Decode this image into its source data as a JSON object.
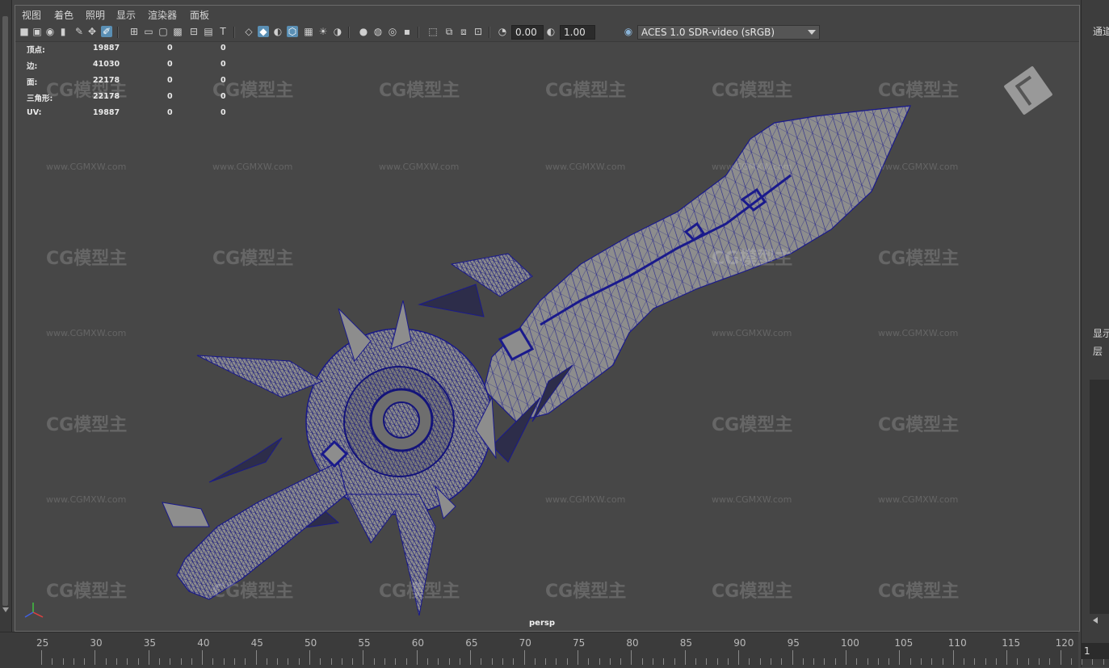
{
  "menu": [
    "视图",
    "着色",
    "照明",
    "显示",
    "渲染器",
    "面板"
  ],
  "toolbar": {
    "exposure_value": "0.00",
    "gamma_value": "1.00",
    "color_space": "ACES 1.0 SDR-video (sRGB)"
  },
  "hud": {
    "rows": [
      {
        "label": "顶点:",
        "total": "19887",
        "selected": "0",
        "tris": "0"
      },
      {
        "label": "边:",
        "total": "41030",
        "selected": "0",
        "tris": "0"
      },
      {
        "label": "面:",
        "total": "22178",
        "selected": "0",
        "tris": "0"
      },
      {
        "label": "三角形:",
        "total": "22178",
        "selected": "0",
        "tris": "0"
      },
      {
        "label": "UV:",
        "total": "19887",
        "selected": "0",
        "tris": "0"
      }
    ]
  },
  "viewport": {
    "camera_label": "persp",
    "watermark_logo": "CG模型主",
    "watermark_url": "www.CGMXW.com"
  },
  "right_panel": {
    "channel_label": "通道",
    "display_label": "显示",
    "layer_label": "层"
  },
  "timeline": {
    "ticks": [
      "25",
      "30",
      "35",
      "40",
      "45",
      "50",
      "55",
      "60",
      "65",
      "70",
      "75",
      "80",
      "85",
      "90",
      "95",
      "100",
      "105",
      "110",
      "115",
      "120"
    ],
    "current_frame": "1"
  },
  "colors": {
    "wire": "#1a1a8c",
    "mesh_fill": "#8d8d8d",
    "viewport_bg": "#474747",
    "active_icon": "#5a8fb4"
  }
}
